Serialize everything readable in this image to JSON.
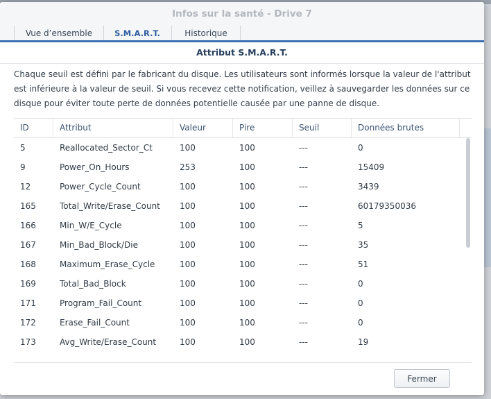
{
  "window": {
    "title": "Infos sur la santé - Drive 7"
  },
  "tabs": [
    {
      "label": "Vue d’ensemble",
      "active": false
    },
    {
      "label": "S.M.A.R.T.",
      "active": true
    },
    {
      "label": "Historique",
      "active": false
    }
  ],
  "section": {
    "title": "Attribut S.M.A.R.T.",
    "description": "Chaque seuil est défini par le fabricant du disque. Les utilisateurs sont informés lorsque la valeur de l'attribut est inférieure à la valeur de seuil. Si vous recevez cette notification, veillez à sauvegarder les données sur ce disque pour éviter toute perte de données potentielle causée par une panne de disque."
  },
  "table": {
    "columns": [
      "ID",
      "Attribut",
      "Valeur",
      "Pire",
      "Seuil",
      "Données brutes"
    ],
    "rows": [
      [
        "5",
        "Reallocated_Sector_Ct",
        "100",
        "100",
        "---",
        "0"
      ],
      [
        "9",
        "Power_On_Hours",
        "253",
        "100",
        "---",
        "15409"
      ],
      [
        "12",
        "Power_Cycle_Count",
        "100",
        "100",
        "---",
        "3439"
      ],
      [
        "165",
        "Total_Write/Erase_Count",
        "100",
        "100",
        "---",
        "60179350036"
      ],
      [
        "166",
        "Min_W/E_Cycle",
        "100",
        "100",
        "---",
        "5"
      ],
      [
        "167",
        "Min_Bad_Block/Die",
        "100",
        "100",
        "---",
        "35"
      ],
      [
        "168",
        "Maximum_Erase_Cycle",
        "100",
        "100",
        "---",
        "51"
      ],
      [
        "169",
        "Total_Bad_Block",
        "100",
        "100",
        "---",
        "0"
      ],
      [
        "171",
        "Program_Fail_Count",
        "100",
        "100",
        "---",
        "0"
      ],
      [
        "172",
        "Erase_Fail_Count",
        "100",
        "100",
        "---",
        "0"
      ],
      [
        "173",
        "Avg_Write/Erase_Count",
        "100",
        "100",
        "---",
        "19"
      ]
    ]
  },
  "footer": {
    "close_label": "Fermer"
  },
  "colors": {
    "accent": "#3b6fb1",
    "title_inactive": "#b3b8bf"
  }
}
